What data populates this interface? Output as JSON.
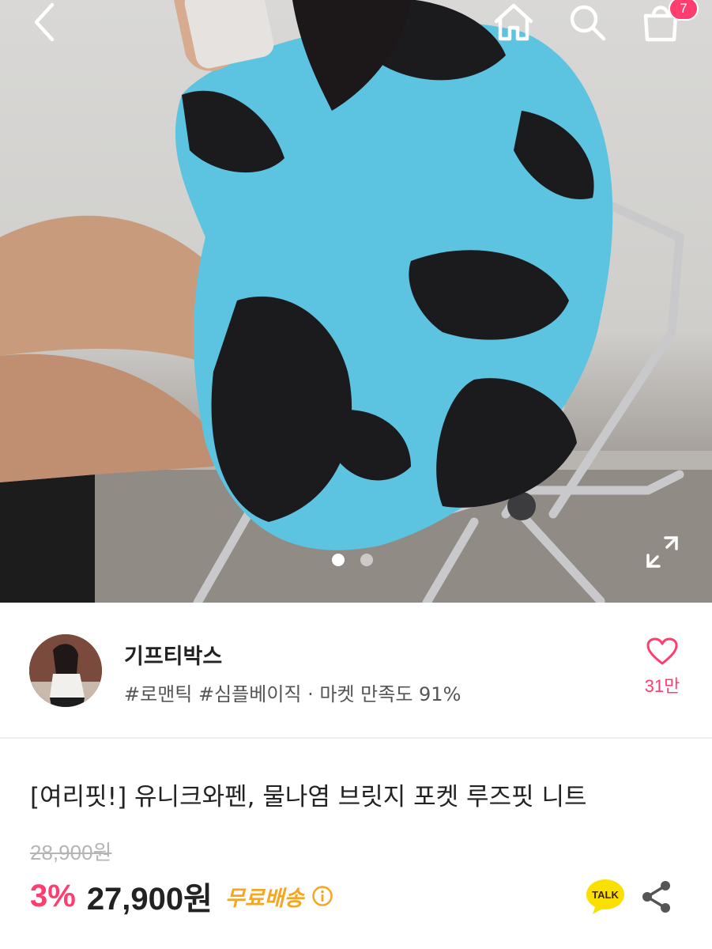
{
  "header": {
    "cart_count": "7",
    "icons": [
      "back-arrow-icon",
      "home-icon",
      "search-icon",
      "shopping-bag-icon"
    ]
  },
  "gallery": {
    "slides": 2,
    "active_slide": 1,
    "expand_icon": "expand-icon"
  },
  "shop": {
    "name": "기프티박스",
    "tags": "#로맨틱 #심플베이직 · 마켓 만족도 91%",
    "like_count": "31만",
    "like_icon": "heart-icon"
  },
  "product": {
    "title": "[여리핏!] 유니크와펜, 물나염 브릿지 포켓 루즈핏 니트",
    "original_price": "28,900원",
    "discount": "3%",
    "sale_price": "27,900원",
    "shipping": "무료배송",
    "talk_label": "TALK"
  },
  "colors": {
    "accent_pink": "#ff3d6e",
    "shipping_orange": "#f5a623",
    "talk_yellow": "#f9e000",
    "sweater_blue": "#5cc3e0",
    "sweater_black": "#1b1b1d"
  }
}
